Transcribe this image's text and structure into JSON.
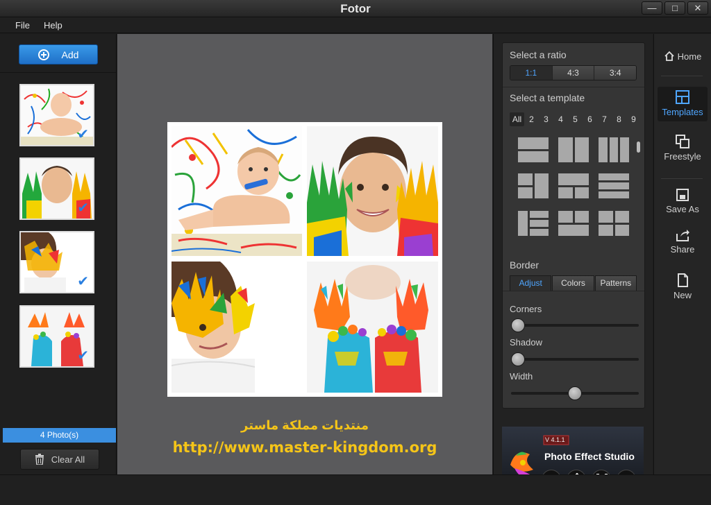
{
  "window": {
    "title": "Fotor"
  },
  "menu": {
    "file": "File",
    "help": "Help"
  },
  "left": {
    "add_label": "Add",
    "count_label": "4 Photo(s)",
    "clear_label": "Clear All"
  },
  "watermark": {
    "arabic": "منتديات مملكة ماستر",
    "url": "http://www.master-kingdom.org"
  },
  "right": {
    "ratio_title": "Select a ratio",
    "ratios": [
      "1:1",
      "4:3",
      "3:4"
    ],
    "selected_ratio": "1:1",
    "template_title": "Select a template",
    "template_filters": [
      "All",
      "2",
      "3",
      "4",
      "5",
      "6",
      "7",
      "8",
      "9"
    ],
    "border_title": "Border",
    "border_tabs": [
      "Adjust",
      "Colors",
      "Patterns"
    ],
    "sliders": [
      {
        "label": "Corners",
        "value": 0
      },
      {
        "label": "Shadow",
        "value": 0
      },
      {
        "label": "Width",
        "value": 0.5
      }
    ],
    "promo": {
      "version": "V 4.1.1",
      "name": "Photo Effect Studio",
      "fx": "Fx"
    }
  },
  "sidebar": {
    "home": "Home",
    "templates": "Templates",
    "freestyle": "Freestyle",
    "save_as": "Save As",
    "share": "Share",
    "new": "New"
  },
  "colors": {
    "accent": "#3b8fe0",
    "watermark": "#f5c518",
    "canvas_bg": "#5a5a5c"
  }
}
